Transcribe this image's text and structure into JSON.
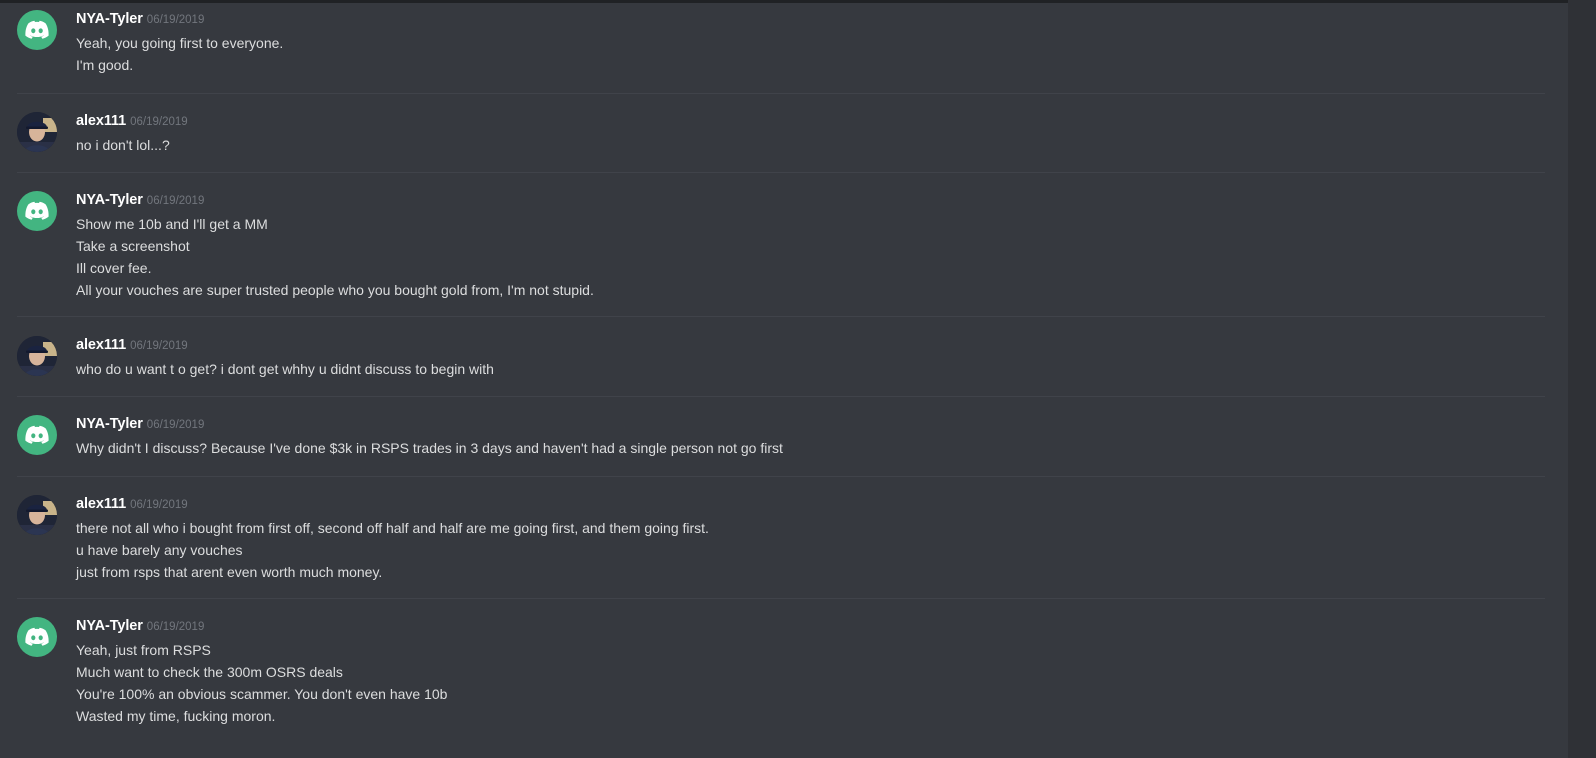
{
  "messages": [
    {
      "author": "NYA-Tyler",
      "avatar": "discord-logo-icon",
      "timestamp": "06/19/2019",
      "lines": [
        "Yeah, you going first to everyone.",
        "I'm good."
      ]
    },
    {
      "author": "alex111",
      "avatar": "user-photo",
      "timestamp": "06/19/2019",
      "lines": [
        "no i don't lol...?"
      ]
    },
    {
      "author": "NYA-Tyler",
      "avatar": "discord-logo-icon",
      "timestamp": "06/19/2019",
      "lines": [
        "Show me 10b and I'll get a MM",
        "Take a screenshot",
        "Ill cover fee.",
        "All your vouches are super trusted people who you bought gold from, I'm not stupid."
      ]
    },
    {
      "author": "alex111",
      "avatar": "user-photo",
      "timestamp": "06/19/2019",
      "lines": [
        "who do u want t o get? i dont get whhy u didnt discuss to begin with"
      ]
    },
    {
      "author": "NYA-Tyler",
      "avatar": "discord-logo-icon",
      "timestamp": "06/19/2019",
      "lines": [
        "Why didn't I discuss? Because I've done $3k in RSPS trades in 3 days and haven't had a single person not go first"
      ]
    },
    {
      "author": "alex111",
      "avatar": "user-photo",
      "timestamp": "06/19/2019",
      "lines": [
        "there not all who i bought from first off, second off half and half are me going first, and them going first.",
        "u have barely any vouches",
        "just from rsps that arent even worth much money."
      ]
    },
    {
      "author": "NYA-Tyler",
      "avatar": "discord-logo-icon",
      "timestamp": "06/19/2019",
      "lines": [
        "Yeah, just from RSPS",
        "Much want to check the 300m OSRS deals",
        "You're 100% an obvious scammer. You don't even have 10b",
        "Wasted my time, fucking moron."
      ]
    }
  ],
  "colors": {
    "background": "#36393f",
    "username": "#ffffff",
    "timestamp": "#72767d",
    "text": "#dcddde",
    "discord_avatar": "#43b581"
  }
}
